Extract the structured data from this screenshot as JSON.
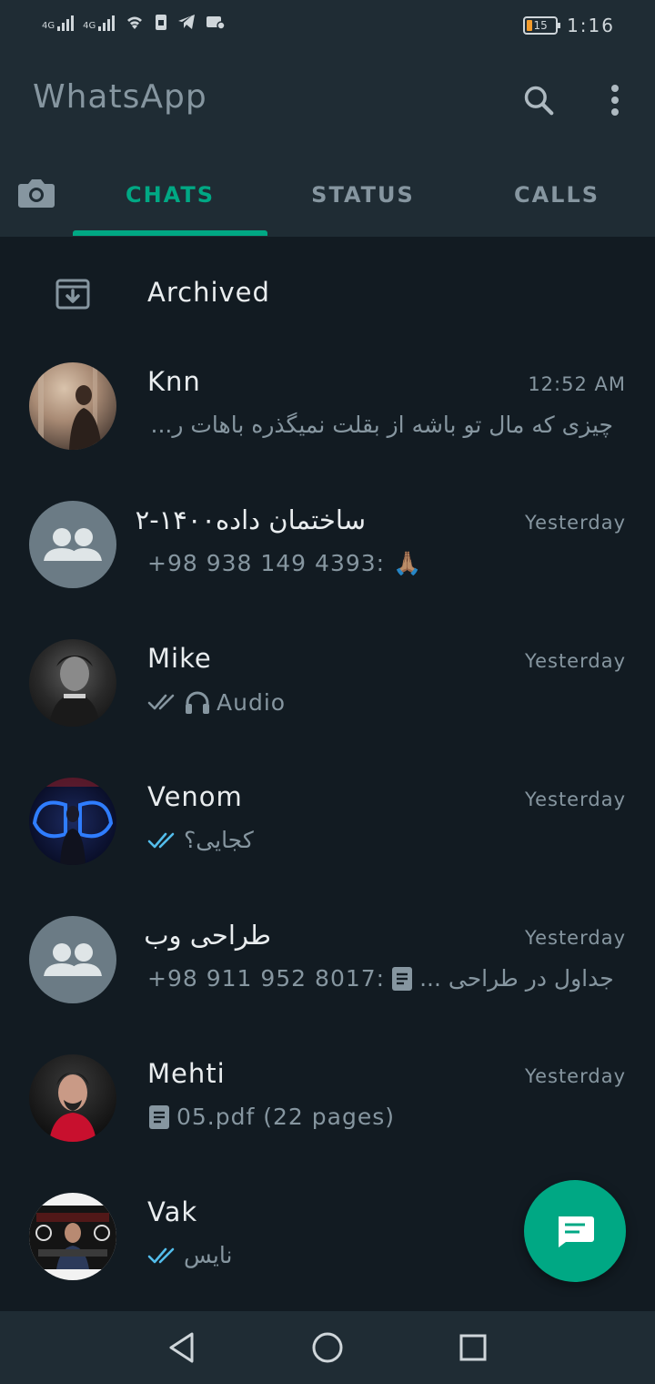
{
  "status_bar": {
    "signal_1": "4G",
    "signal_2": "4G",
    "battery_level": "15",
    "time": "1:16",
    "icons": [
      "signal-icon",
      "wifi-icon",
      "sim-icon",
      "telegram-icon",
      "mail-icon"
    ]
  },
  "header": {
    "title": "WhatsApp",
    "search_icon": "search-icon",
    "menu_icon": "more-vert-icon"
  },
  "tabs": [
    {
      "label": "CHATS",
      "active": true
    },
    {
      "label": "STATUS",
      "active": false
    },
    {
      "label": "CALLS",
      "active": false
    }
  ],
  "archived": {
    "label": "Archived"
  },
  "chats": [
    {
      "name": "Knn",
      "time": "12:52 AM",
      "preview": "چیزی که مال تو باشه از بقلت نمیگذره باهات ر...",
      "avatar": "photo"
    },
    {
      "name": "ساختمان داده۱۴۰۰-۲",
      "time": "Yesterday",
      "preview": "+98 938 149 4393: 🙏🏽",
      "avatar": "group"
    },
    {
      "name": "Mike",
      "time": "Yesterday",
      "preview": "Audio",
      "avatar": "photo"
    },
    {
      "name": "Venom",
      "time": "Yesterday",
      "preview": "کجایی؟",
      "avatar": "photo"
    },
    {
      "name": "طراحی وب",
      "time": "Yesterday",
      "preview_sender": "+98 911 952 8017:",
      "preview": "جداول در طراحی ...",
      "avatar": "group"
    },
    {
      "name": "Mehti",
      "time": "Yesterday",
      "preview": "05.pdf (22 pages)",
      "avatar": "photo"
    },
    {
      "name": "Vak",
      "time": "",
      "preview": "نایس",
      "avatar": "photo"
    }
  ],
  "colors": {
    "accent": "#00a884",
    "background": "#121b22",
    "header": "#1f2c34",
    "secondary_text": "#8696a0",
    "read_tick": "#53bdeb"
  }
}
